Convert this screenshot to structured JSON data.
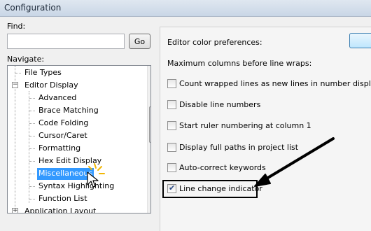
{
  "window": {
    "title": "Configuration"
  },
  "find": {
    "label": "Find:",
    "value": "",
    "go_label": "Go"
  },
  "navigate": {
    "label": "Navigate:",
    "items": [
      {
        "label": "File Types",
        "depth": 1
      },
      {
        "label": "Editor Display",
        "depth": 1,
        "expanded": true
      },
      {
        "label": "Advanced",
        "depth": 2
      },
      {
        "label": "Brace Matching",
        "depth": 2
      },
      {
        "label": "Code Folding",
        "depth": 2
      },
      {
        "label": "Cursor/Caret",
        "depth": 2
      },
      {
        "label": "Formatting",
        "depth": 2
      },
      {
        "label": "Hex Edit Display",
        "depth": 2
      },
      {
        "label": "Miscellaneous",
        "depth": 2,
        "selected": true
      },
      {
        "label": "Syntax Highlighting",
        "depth": 2
      },
      {
        "label": "Function List",
        "depth": 2
      },
      {
        "label": "Application Layout",
        "depth": 1,
        "expanded": false
      }
    ]
  },
  "preferences": {
    "color_label": "Editor color preferences:",
    "max_columns_label": "Maximum columns before line wraps:",
    "options": [
      {
        "label": "Count wrapped lines as new lines in number display",
        "checked": false
      },
      {
        "label": "Disable line numbers",
        "checked": false
      },
      {
        "label": "Start ruler numbering at column 1",
        "checked": false
      },
      {
        "label": "Display full paths in project list",
        "checked": false
      },
      {
        "label": "Auto-correct keywords",
        "checked": false
      },
      {
        "label": "Line change indicator",
        "checked": true
      }
    ]
  },
  "colors": {
    "selection": "#3399ff",
    "accent_button": "#bee6fd"
  },
  "icons": [
    "expander-minus-icon",
    "expander-plus-icon",
    "scroll-up-arrow-icon",
    "scroll-down-arrow-icon",
    "mouse-cursor-icon",
    "click-burst-icon",
    "annotation-arrow-icon"
  ]
}
